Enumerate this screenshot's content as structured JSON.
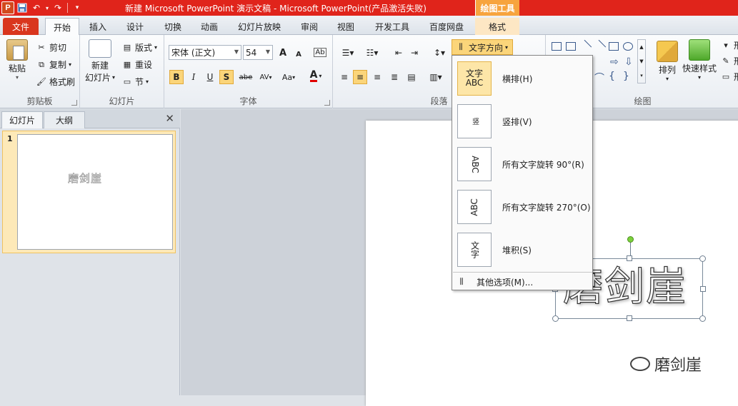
{
  "titlebar": {
    "title": "新建 Microsoft PowerPoint 演示文稿  -  Microsoft PowerPoint(产品激活失败)",
    "context_tool": "绘图工具",
    "logo": "P"
  },
  "tabs": {
    "file": "文件",
    "home": "开始",
    "insert": "插入",
    "design": "设计",
    "transitions": "切换",
    "animations": "动画",
    "slideshow": "幻灯片放映",
    "review": "审阅",
    "view": "视图",
    "developer": "开发工具",
    "baidu": "百度网盘",
    "format": "格式"
  },
  "ribbon": {
    "clipboard": {
      "label": "剪贴板",
      "paste": "粘贴",
      "cut": "剪切",
      "copy": "复制",
      "format_painter": "格式刷"
    },
    "slides": {
      "label": "幻灯片",
      "new_slide_line1": "新建",
      "new_slide_line2": "幻灯片",
      "layout": "版式",
      "reset": "重设",
      "section": "节"
    },
    "font": {
      "label": "字体",
      "font_name": "宋体 (正文)",
      "font_size": "54",
      "grow": "A",
      "shrink": "A",
      "bold": "B",
      "italic": "I",
      "underline": "U",
      "shadow": "S",
      "strike": "abe",
      "spacing": "AV",
      "case": "Aa",
      "color": "A"
    },
    "paragraph": {
      "label": "段落",
      "text_direction": "文字方向"
    },
    "drawing": {
      "label": "绘图",
      "arrange": "排列",
      "quick_styles": "快速样式",
      "shape_fill": "形",
      "shape_outline": "形",
      "shape_effects": "形"
    }
  },
  "menu": {
    "items": [
      {
        "icon_text": "文字\nABC",
        "label": "横排(H)",
        "name": "horizontal"
      },
      {
        "icon_text": "竖",
        "label": "竖排(V)",
        "name": "vertical"
      },
      {
        "icon_text": "ABC",
        "label": "所有文字旋转 90°(R)",
        "name": "rotate-90"
      },
      {
        "icon_text": "ABC",
        "label": "所有文字旋转 270°(O)",
        "name": "rotate-270"
      },
      {
        "icon_text": "文字",
        "label": "堆积(S)",
        "name": "stacked"
      }
    ],
    "more": "其他选项(M)..."
  },
  "leftpanel": {
    "tab_slides": "幻灯片",
    "tab_outline": "大纲",
    "close": "✕",
    "slide_number": "1",
    "thumb_text": "磨剑崖"
  },
  "slide": {
    "textbox_text": "磨剑崖",
    "watermark_text": "磨剑崖"
  }
}
